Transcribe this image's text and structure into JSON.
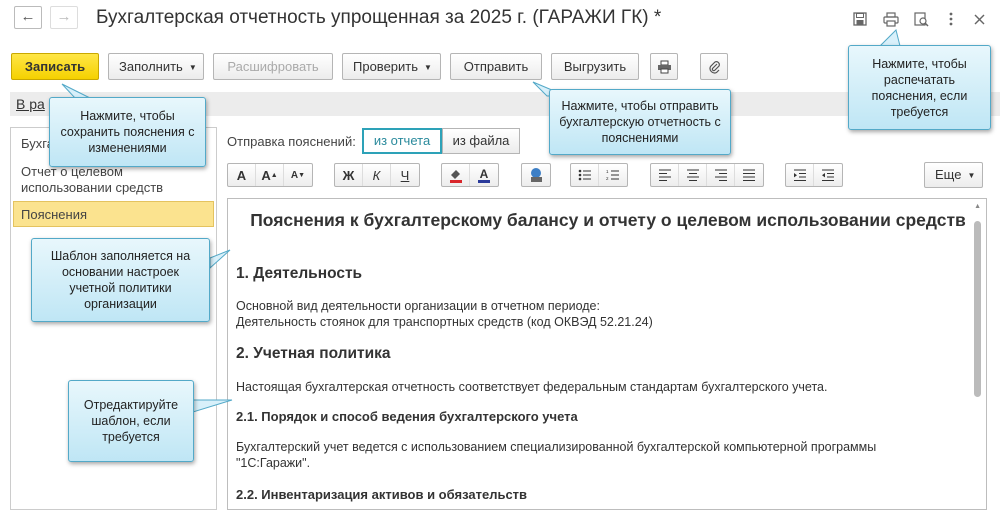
{
  "window": {
    "title": "Бухгалтерская отчетность упрощенная за 2025 г. (ГАРАЖИ ГК) *",
    "back_icon": "←",
    "forward_icon": "→"
  },
  "toolbar": {
    "save": "Записать",
    "fill": "Заполнить",
    "decode": "Расшифровать",
    "check": "Проверить",
    "send": "Отправить",
    "export": "Выгрузить"
  },
  "status_link": "В ра",
  "sidebar": {
    "items": [
      {
        "label": "Бухга"
      },
      {
        "label": "Отчет о целевом\nиспользовании средств"
      },
      {
        "label": "Пояснения"
      }
    ]
  },
  "sending": {
    "label": "Отправка пояснений:",
    "from_report": "из отчета",
    "from_file": "из файла"
  },
  "format": {
    "more": "Еще",
    "bold": "Ж",
    "italic": "К",
    "underline": "Ч"
  },
  "document": {
    "title": "Пояснения к бухгалтерскому балансу и отчету о целевом использовании средств",
    "s1_heading": "1. Деятельность",
    "s1_text": "Основной вид деятельности организации в отчетном периоде:\nДеятельность стоянок для транспортных средств (код ОКВЭД 52.21.24)",
    "s2_heading": "2. Учетная политика",
    "s2_text": "Настоящая бухгалтерская отчетность соответствует федеральным стандартам бухгалтерского учета.",
    "s21_heading": "2.1. Порядок и способ ведения бухгалтерского учета",
    "s21_text": "Бухгалтерский учет ведется с использованием специализированной бухгалтерской компьютерной программы\n\"1С:Гаражи\".",
    "s22_heading": "2.2. Инвентаризация активов и обязательств"
  },
  "callouts": {
    "save": "Нажмите, чтобы сохранить пояснения с изменениями",
    "send": "Нажмите, чтобы отправить бухгалтерскую отчетность с пояснениями",
    "print": "Нажмите, чтобы распечатать пояснения, если требуется",
    "template": "Шаблон заполняется на основании настроек учетной политики организации",
    "edit": "Отредактируйте шаблон, если требуется"
  },
  "colors": {
    "primary_button": "#f5d100",
    "selected_item": "#fbe38f",
    "active_tab_border": "#2da2b8",
    "callout_bg": "#bfe6f5"
  }
}
